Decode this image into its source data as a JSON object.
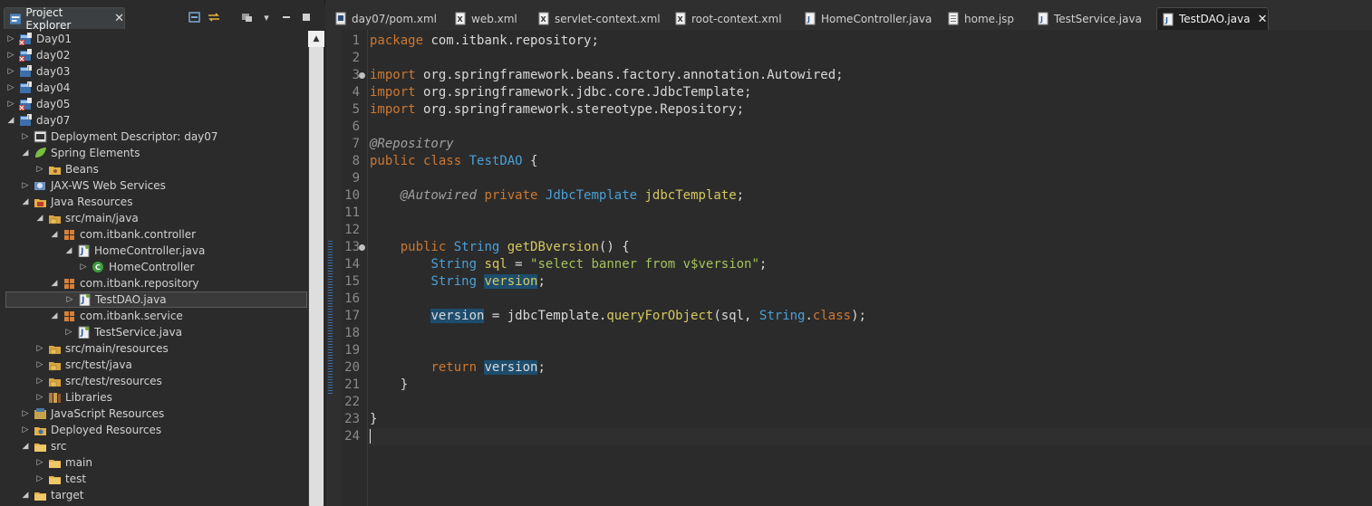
{
  "explorer": {
    "title": "Project Explorer",
    "tree": [
      {
        "label": "Day01",
        "indent": 0,
        "state": "closed",
        "icon": "project-error-icon"
      },
      {
        "label": "day02",
        "indent": 0,
        "state": "closed",
        "icon": "project-error-icon"
      },
      {
        "label": "day03",
        "indent": 0,
        "state": "closed",
        "icon": "project-icon"
      },
      {
        "label": "day04",
        "indent": 0,
        "state": "closed",
        "icon": "project-icon"
      },
      {
        "label": "day05",
        "indent": 0,
        "state": "closed",
        "icon": "project-error-icon"
      },
      {
        "label": "day07",
        "indent": 0,
        "state": "open",
        "icon": "project-icon"
      },
      {
        "label": "Deployment Descriptor: day07",
        "indent": 1,
        "state": "closed",
        "icon": "descriptor-icon"
      },
      {
        "label": "Spring Elements",
        "indent": 1,
        "state": "open",
        "icon": "spring-leaf-icon"
      },
      {
        "label": "Beans",
        "indent": 2,
        "state": "closed",
        "icon": "beans-folder-icon"
      },
      {
        "label": "JAX-WS Web Services",
        "indent": 1,
        "state": "closed",
        "icon": "webservice-icon"
      },
      {
        "label": "Java Resources",
        "indent": 1,
        "state": "open",
        "icon": "java-resources-icon"
      },
      {
        "label": "src/main/java",
        "indent": 2,
        "state": "open",
        "icon": "source-folder-icon"
      },
      {
        "label": "com.itbank.controller",
        "indent": 3,
        "state": "open",
        "icon": "package-icon"
      },
      {
        "label": "HomeController.java",
        "indent": 4,
        "state": "open",
        "icon": "java-file-icon"
      },
      {
        "label": "HomeController",
        "indent": 5,
        "state": "closed",
        "icon": "class-icon"
      },
      {
        "label": "com.itbank.repository",
        "indent": 3,
        "state": "open",
        "icon": "package-icon"
      },
      {
        "label": "TestDAO.java",
        "indent": 4,
        "state": "closed",
        "icon": "java-file-icon",
        "selected": true
      },
      {
        "label": "com.itbank.service",
        "indent": 3,
        "state": "open",
        "icon": "package-icon"
      },
      {
        "label": "TestService.java",
        "indent": 4,
        "state": "closed",
        "icon": "java-file-icon"
      },
      {
        "label": "src/main/resources",
        "indent": 2,
        "state": "closed",
        "icon": "source-folder-icon"
      },
      {
        "label": "src/test/java",
        "indent": 2,
        "state": "closed",
        "icon": "source-folder-icon"
      },
      {
        "label": "src/test/resources",
        "indent": 2,
        "state": "closed",
        "icon": "source-folder-icon"
      },
      {
        "label": "Libraries",
        "indent": 2,
        "state": "closed",
        "icon": "libraries-icon"
      },
      {
        "label": "JavaScript Resources",
        "indent": 1,
        "state": "closed",
        "icon": "javascript-resources-icon"
      },
      {
        "label": "Deployed Resources",
        "indent": 1,
        "state": "closed",
        "icon": "deployed-resources-icon"
      },
      {
        "label": "src",
        "indent": 1,
        "state": "open",
        "icon": "folder-icon"
      },
      {
        "label": "main",
        "indent": 2,
        "state": "closed",
        "icon": "folder-icon"
      },
      {
        "label": "test",
        "indent": 2,
        "state": "closed",
        "icon": "folder-icon"
      },
      {
        "label": "target",
        "indent": 1,
        "state": "open",
        "icon": "folder-icon"
      }
    ]
  },
  "editor_tabs": [
    {
      "label": "day07/pom.xml",
      "icon": "maven-icon"
    },
    {
      "label": "web.xml",
      "icon": "xml-file-icon"
    },
    {
      "label": "servlet-context.xml",
      "icon": "xml-file-icon"
    },
    {
      "label": "root-context.xml",
      "icon": "xml-file-icon"
    },
    {
      "label": "HomeController.java",
      "icon": "java-file-icon"
    },
    {
      "label": "home.jsp",
      "icon": "jsp-file-icon"
    },
    {
      "label": "TestService.java",
      "icon": "java-file-icon"
    },
    {
      "label": "TestDAO.java",
      "icon": "java-file-icon",
      "active": true
    }
  ],
  "code": {
    "line_numbers": [
      "1",
      "2",
      "3",
      "4",
      "5",
      "6",
      "7",
      "8",
      "9",
      "10",
      "11",
      "12",
      "13",
      "14",
      "15",
      "16",
      "17",
      "18",
      "19",
      "20",
      "21",
      "22",
      "23",
      "24"
    ],
    "lines": [
      [
        {
          "t": "package",
          "c": "kw"
        },
        {
          "t": " com.itbank.repository;"
        }
      ],
      [],
      [
        {
          "t": "import",
          "c": "kw"
        },
        {
          "t": " org.springframework.beans.factory.annotation.Autowired;"
        }
      ],
      [
        {
          "t": "import",
          "c": "kw"
        },
        {
          "t": " org.springframework.jdbc.core.JdbcTemplate;"
        }
      ],
      [
        {
          "t": "import",
          "c": "kw"
        },
        {
          "t": " org.springframework.stereotype.Repository;"
        }
      ],
      [],
      [
        {
          "t": "@Repository",
          "c": "ann"
        }
      ],
      [
        {
          "t": "public",
          "c": "kw"
        },
        {
          "t": " "
        },
        {
          "t": "class",
          "c": "kw"
        },
        {
          "t": " "
        },
        {
          "t": "TestDAO",
          "c": "typ"
        },
        {
          "t": " {"
        }
      ],
      [],
      [
        {
          "t": "    "
        },
        {
          "t": "@Autowired",
          "c": "ann"
        },
        {
          "t": " "
        },
        {
          "t": "private",
          "c": "kw"
        },
        {
          "t": " "
        },
        {
          "t": "JdbcTemplate",
          "c": "typ"
        },
        {
          "t": " "
        },
        {
          "t": "jdbcTemplate",
          "c": "fn"
        },
        {
          "t": ";"
        }
      ],
      [],
      [],
      [
        {
          "t": "    "
        },
        {
          "t": "public",
          "c": "kw"
        },
        {
          "t": " "
        },
        {
          "t": "String",
          "c": "typ"
        },
        {
          "t": " "
        },
        {
          "t": "getDBversion",
          "c": "fn"
        },
        {
          "t": "() {"
        }
      ],
      [
        {
          "t": "        "
        },
        {
          "t": "String",
          "c": "typ"
        },
        {
          "t": " "
        },
        {
          "t": "sql",
          "c": "fn"
        },
        {
          "t": " = "
        },
        {
          "t": "\"select banner from v$version\"",
          "c": "str"
        },
        {
          "t": ";"
        }
      ],
      [
        {
          "t": "        "
        },
        {
          "t": "String",
          "c": "typ"
        },
        {
          "t": " "
        },
        {
          "t": "version",
          "c": "fn hl"
        },
        {
          "t": ";"
        }
      ],
      [],
      [
        {
          "t": "        "
        },
        {
          "t": "version",
          "c": "var hl"
        },
        {
          "t": " = jdbcTemplate."
        },
        {
          "t": "queryForObject",
          "c": "fn"
        },
        {
          "t": "(sql, "
        },
        {
          "t": "String",
          "c": "typ"
        },
        {
          "t": "."
        },
        {
          "t": "class",
          "c": "kw"
        },
        {
          "t": ");"
        }
      ],
      [],
      [],
      [
        {
          "t": "        "
        },
        {
          "t": "return",
          "c": "kw"
        },
        {
          "t": " "
        },
        {
          "t": "version",
          "c": "var hl"
        },
        {
          "t": ";"
        }
      ],
      [
        {
          "t": "    }"
        }
      ],
      [],
      [
        {
          "t": "}"
        }
      ],
      []
    ]
  }
}
